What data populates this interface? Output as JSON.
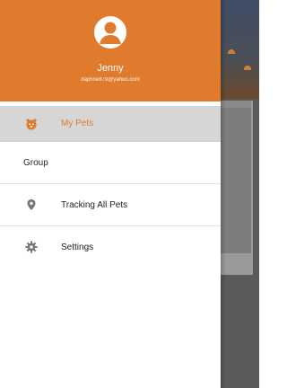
{
  "user": {
    "name": "Jenny",
    "email": "daphne879@yahoo.com"
  },
  "menu": {
    "items": [
      {
        "label": "My Pets",
        "icon": "paw-icon",
        "active": true
      },
      {
        "label": "Group",
        "icon": "",
        "active": false
      },
      {
        "label": "Tracking All Pets",
        "icon": "location-pin-icon",
        "active": false
      },
      {
        "label": "Settings",
        "icon": "gear-icon",
        "active": false
      }
    ]
  },
  "colors": {
    "accent": "#e07a2c",
    "active_row": "#d6d6d6",
    "text": "#222222"
  }
}
